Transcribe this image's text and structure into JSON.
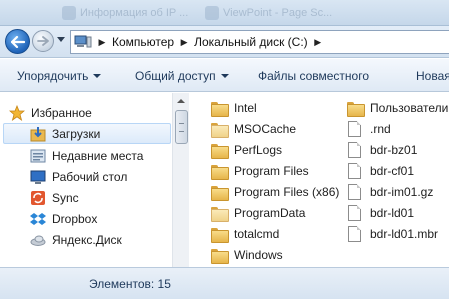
{
  "taskbar": {
    "items": [
      "Информация об IP ...",
      "ViewPoint - Page Sc..."
    ]
  },
  "address": {
    "crumbs": [
      "Компьютер",
      "Локальный диск (C:)"
    ]
  },
  "toolbar": {
    "organize_label": "Упорядочить",
    "share_label": "Общий доступ",
    "sharing_files_label": "Файлы совместного",
    "new_label": "Новая"
  },
  "sidebar": {
    "favorites_label": "Избранное",
    "items": [
      {
        "label": "Загрузки",
        "icon": "downloads-icon"
      },
      {
        "label": "Недавние места",
        "icon": "recent-places-icon"
      },
      {
        "label": "Рабочий стол",
        "icon": "desktop-icon"
      },
      {
        "label": "Sync",
        "icon": "sync-icon"
      },
      {
        "label": "Dropbox",
        "icon": "dropbox-icon"
      },
      {
        "label": "Яндекс.Диск",
        "icon": "yandex-disk-icon"
      }
    ]
  },
  "files": {
    "column1": [
      {
        "name": "Intel",
        "type": "folder"
      },
      {
        "name": "MSOCache",
        "type": "folder-light"
      },
      {
        "name": "PerfLogs",
        "type": "folder"
      },
      {
        "name": "Program Files",
        "type": "folder"
      },
      {
        "name": "Program Files (x86)",
        "type": "folder"
      },
      {
        "name": "ProgramData",
        "type": "folder-light"
      },
      {
        "name": "totalcmd",
        "type": "folder"
      },
      {
        "name": "Windows",
        "type": "folder"
      }
    ],
    "column2": [
      {
        "name": "Пользователи",
        "type": "folder"
      },
      {
        "name": ".rnd",
        "type": "file"
      },
      {
        "name": "bdr-bz01",
        "type": "file"
      },
      {
        "name": "bdr-cf01",
        "type": "file"
      },
      {
        "name": "bdr-im01.gz",
        "type": "file"
      },
      {
        "name": "bdr-ld01",
        "type": "file"
      },
      {
        "name": "bdr-ld01.mbr",
        "type": "file"
      }
    ]
  },
  "status": {
    "items_count": "Элементов: 15"
  },
  "colors": {
    "accent": "#1e395b",
    "folder": "#e6b54b",
    "selection": "#dceafa"
  }
}
